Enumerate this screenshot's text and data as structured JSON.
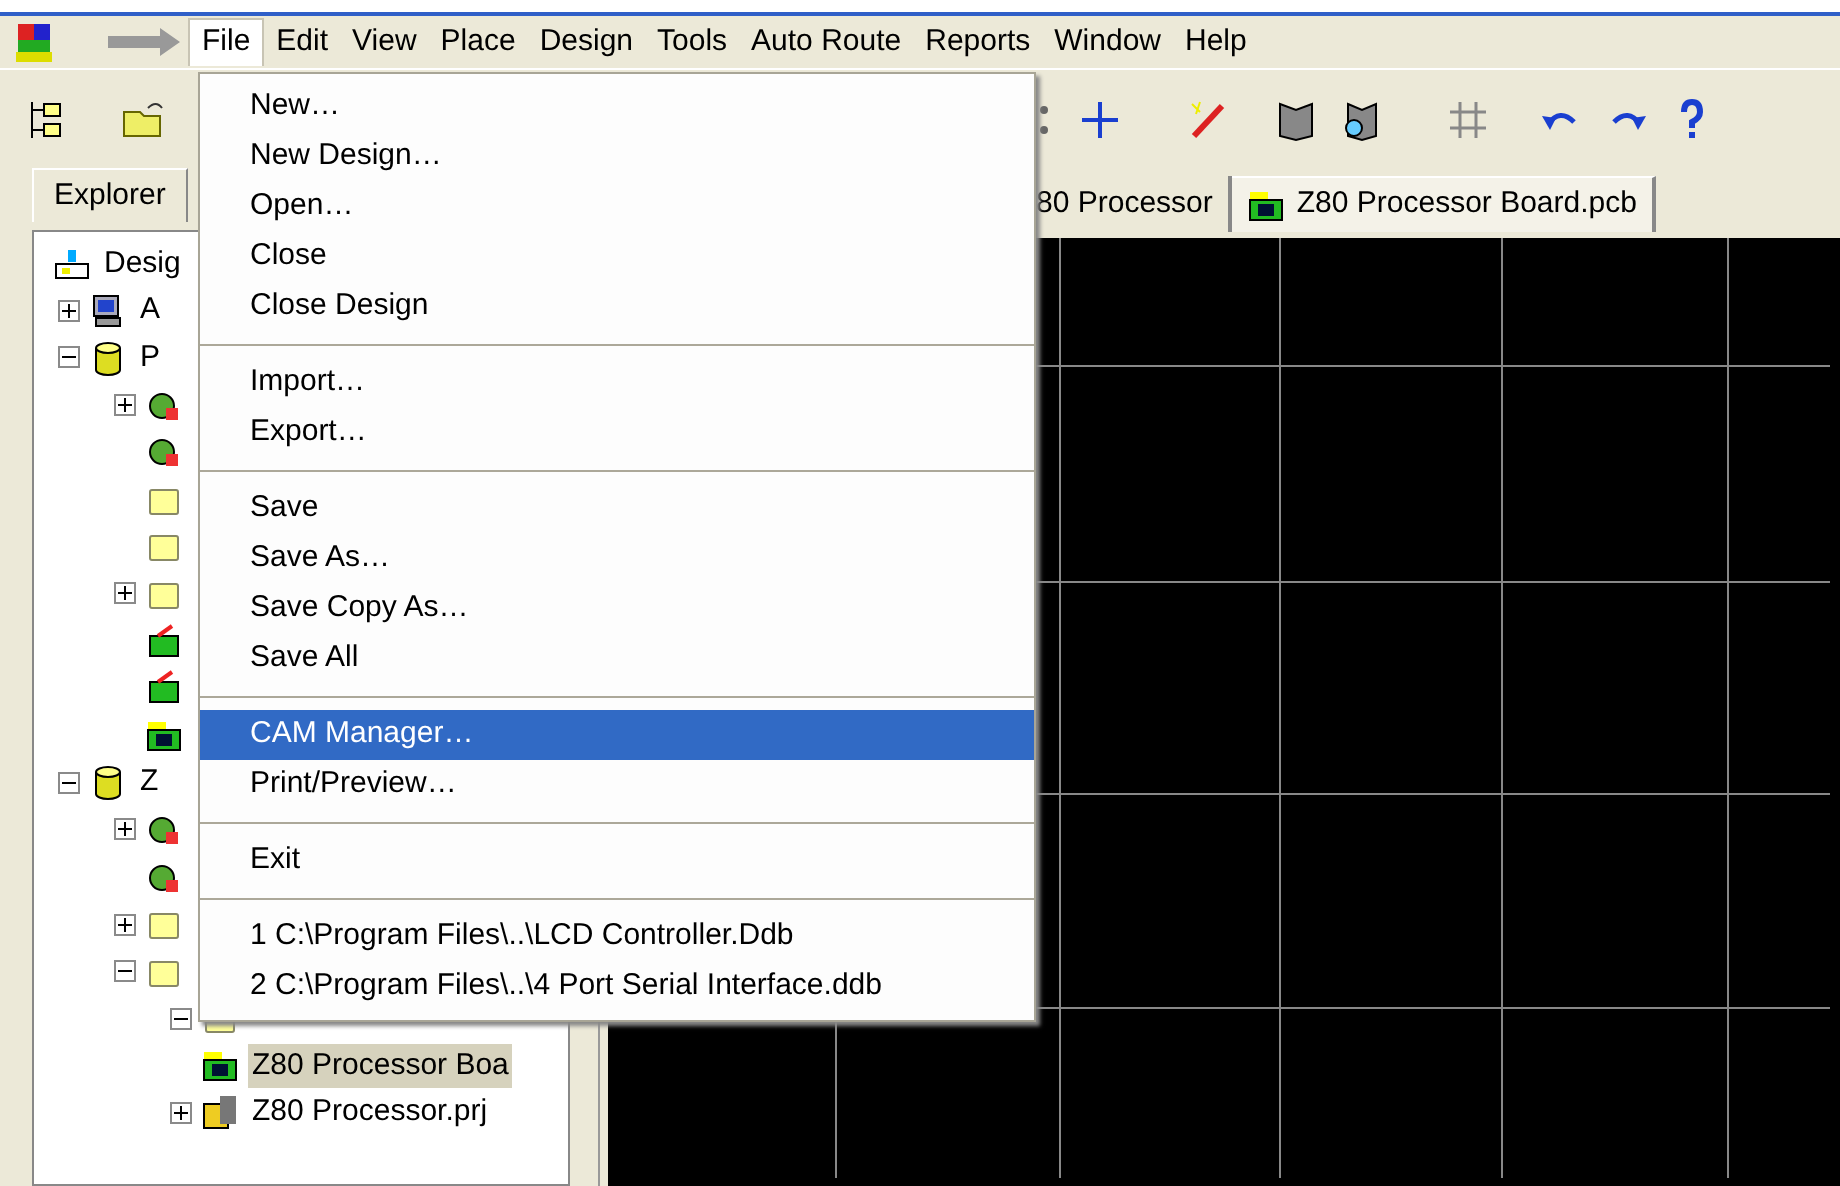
{
  "menubar": [
    {
      "label": "File",
      "selected": true
    },
    {
      "label": "Edit",
      "selected": false
    },
    {
      "label": "View",
      "selected": false
    },
    {
      "label": "Place",
      "selected": false
    },
    {
      "label": "Design",
      "selected": false
    },
    {
      "label": "Tools",
      "selected": false
    },
    {
      "label": "Auto Route",
      "selected": false
    },
    {
      "label": "Reports",
      "selected": false
    },
    {
      "label": "Window",
      "selected": false
    },
    {
      "label": "Help",
      "selected": false
    }
  ],
  "file_menu": [
    {
      "kind": "item",
      "label": "New…",
      "selected": false
    },
    {
      "kind": "item",
      "label": "New Design…",
      "selected": false
    },
    {
      "kind": "item",
      "label": "Open…",
      "selected": false
    },
    {
      "kind": "item",
      "label": "Close",
      "selected": false
    },
    {
      "kind": "item",
      "label": "Close Design",
      "selected": false
    },
    {
      "kind": "separator"
    },
    {
      "kind": "item",
      "label": "Import…",
      "selected": false
    },
    {
      "kind": "item",
      "label": "Export…",
      "selected": false
    },
    {
      "kind": "separator"
    },
    {
      "kind": "item",
      "label": "Save",
      "selected": false
    },
    {
      "kind": "item",
      "label": "Save As…",
      "selected": false
    },
    {
      "kind": "item",
      "label": "Save Copy As…",
      "selected": false
    },
    {
      "kind": "item",
      "label": "Save All",
      "selected": false
    },
    {
      "kind": "separator"
    },
    {
      "kind": "item",
      "label": "CAM Manager…",
      "selected": true
    },
    {
      "kind": "item",
      "label": "Print/Preview…",
      "selected": false
    },
    {
      "kind": "separator"
    },
    {
      "kind": "item",
      "label": "Exit",
      "selected": false
    },
    {
      "kind": "separator"
    },
    {
      "kind": "item",
      "label": "1 C:\\Program Files\\..\\LCD Controller.Ddb",
      "selected": false
    },
    {
      "kind": "item",
      "label": "2 C:\\Program Files\\..\\4 Port Serial Interface.ddb",
      "selected": false
    }
  ],
  "explorer": {
    "tab": "Explorer",
    "tree": [
      {
        "kind": "design",
        "label": "Desig",
        "selected": false,
        "children": [
          {
            "kind": "computer",
            "label": "A",
            "expanded": false,
            "selected": false
          },
          {
            "kind": "database",
            "label": "P",
            "expanded": true,
            "selected": false,
            "children": [
              {
                "kind": "document",
                "expanded": false,
                "selected": false
              },
              {
                "kind": "document",
                "selected": false
              },
              {
                "kind": "folder",
                "selected": false
              },
              {
                "kind": "folder",
                "selected": false
              },
              {
                "kind": "folder",
                "expanded": false,
                "selected": false
              },
              {
                "kind": "pcb",
                "selected": false
              },
              {
                "kind": "pcb",
                "selected": false
              },
              {
                "kind": "board",
                "selected": false
              }
            ]
          },
          {
            "kind": "database",
            "label": "Z",
            "expanded": true,
            "selected": false,
            "children": [
              {
                "kind": "document",
                "expanded": false,
                "selected": false
              },
              {
                "kind": "document",
                "selected": false
              },
              {
                "kind": "folder",
                "expanded": false,
                "selected": false
              },
              {
                "kind": "folder",
                "expanded": true,
                "selected": false,
                "children": [
                  {
                    "kind": "folder",
                    "expanded": true,
                    "selected": false
                  },
                  {
                    "kind": "board",
                    "label": "Z80 Processor Boa",
                    "selected": true
                  },
                  {
                    "kind": "project",
                    "label": "Z80 Processor.prj",
                    "expanded": false,
                    "selected": false
                  }
                ]
              }
            ]
          }
        ]
      }
    ]
  },
  "document_tabs": [
    {
      "label": "80 Processor",
      "kind": "plain",
      "selected": false
    },
    {
      "label": "Z80 Processor Board.pcb",
      "kind": "board",
      "selected": true
    }
  ]
}
